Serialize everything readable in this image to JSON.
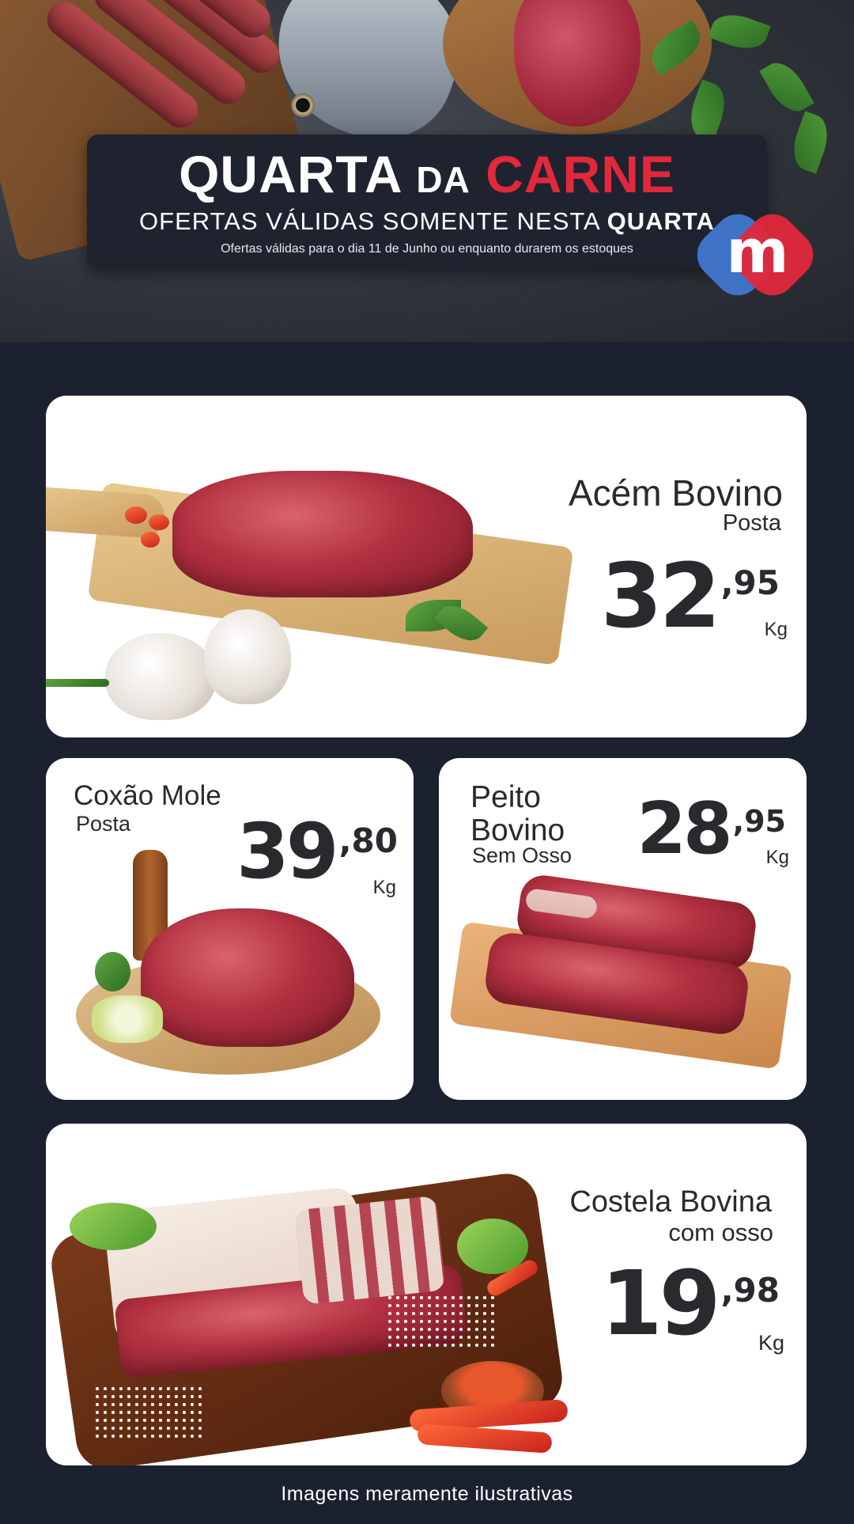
{
  "header": {
    "title_part1": "QUARTA",
    "title_part2": "DA",
    "title_part3": "CARNE",
    "subtitle_prefix": "OFERTAS VÁLIDAS SOMENTE NESTA",
    "subtitle_bold": "QUARTA",
    "note": "Ofertas válidas para o dia 11 de Junho ou enquanto durarem os estoques"
  },
  "brand": {
    "logo_letter": "m",
    "colors": {
      "blue": "#3e73c8",
      "red": "#e2283c"
    }
  },
  "theme": {
    "background": "#1c2130",
    "accent_red": "#e2283c",
    "card": "#ffffff"
  },
  "products": [
    {
      "name": "Acém Bovino",
      "desc": "Posta",
      "price_int": "32",
      "price_cents": ",95",
      "unit": "Kg",
      "image": "chuck-steak-on-board-image"
    },
    {
      "name": "Coxão Mole",
      "desc": "Posta",
      "price_int": "39",
      "price_cents": ",80",
      "unit": "Kg",
      "image": "topside-roast-image"
    },
    {
      "name_line1": "Peito",
      "name_line2": "Bovino",
      "desc": "Sem Osso",
      "price_int": "28",
      "price_cents": ",95",
      "unit": "Kg",
      "image": "brisket-on-board-image"
    },
    {
      "name": "Costela Bovina",
      "desc": "com osso",
      "price_int": "19",
      "price_cents": ",98",
      "unit": "Kg",
      "image": "beef-ribs-on-board-image"
    }
  ],
  "footer": {
    "disclaimer": "Imagens meramente ilustrativas"
  }
}
